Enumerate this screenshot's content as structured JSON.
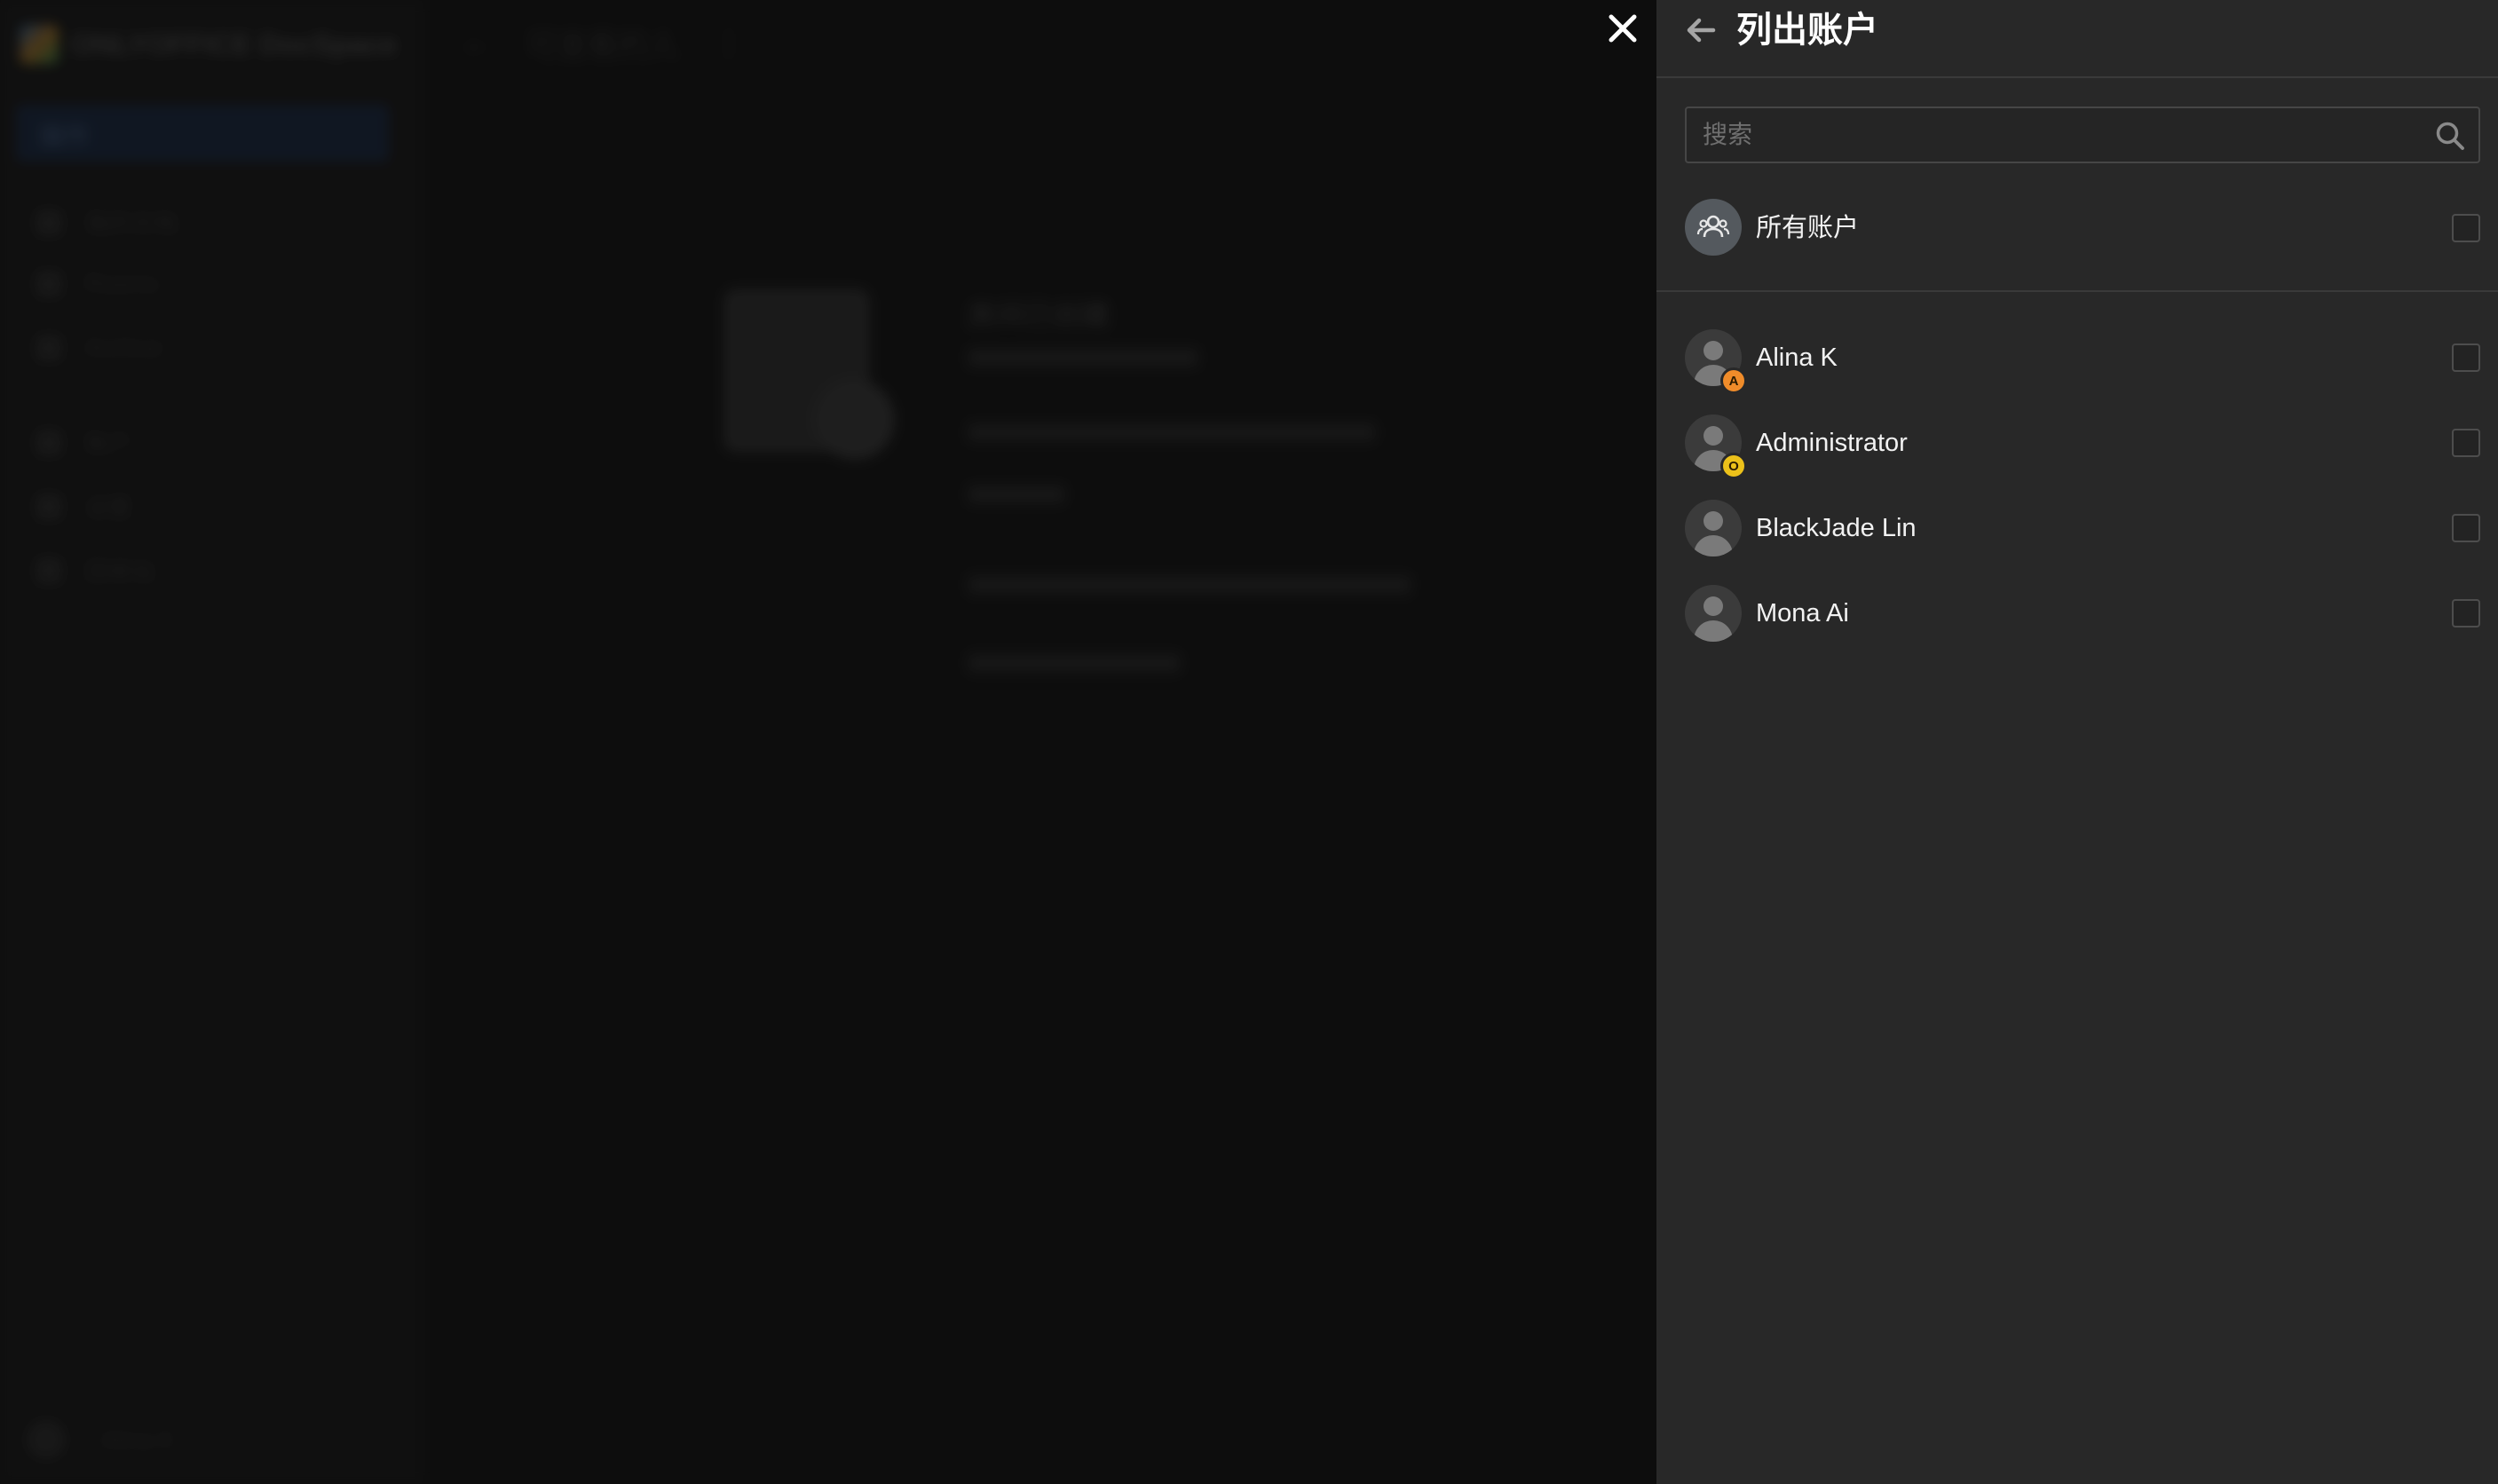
{
  "background": {
    "logo_text": "ONLYOFFICE DocSpace",
    "action_label": "操作",
    "nav_items": [
      "我的文档",
      "Rooms",
      "Archive",
      "账户",
      "设置",
      "回收站"
    ],
    "top_title": "可查看的人",
    "empty_title": "房间已创建",
    "footer_user": "Alina K"
  },
  "close_icon": "close-icon",
  "panel": {
    "title": "列出账户",
    "back_icon": "arrow-left-icon",
    "search": {
      "placeholder": "搜索",
      "value": "",
      "icon": "search-icon"
    },
    "all_accounts": {
      "label": "所有账户",
      "icon": "group-icon",
      "checked": false
    },
    "users": [
      {
        "name": "Alina K",
        "badge": "A",
        "badge_color": "#f08c2a",
        "checked": false
      },
      {
        "name": "Administrator",
        "badge": "O",
        "badge_color": "#ecc11a",
        "checked": false
      },
      {
        "name": "BlackJade Lin",
        "badge": "",
        "badge_color": "",
        "checked": false
      },
      {
        "name": "Mona Ai",
        "badge": "",
        "badge_color": "",
        "checked": false
      }
    ]
  }
}
